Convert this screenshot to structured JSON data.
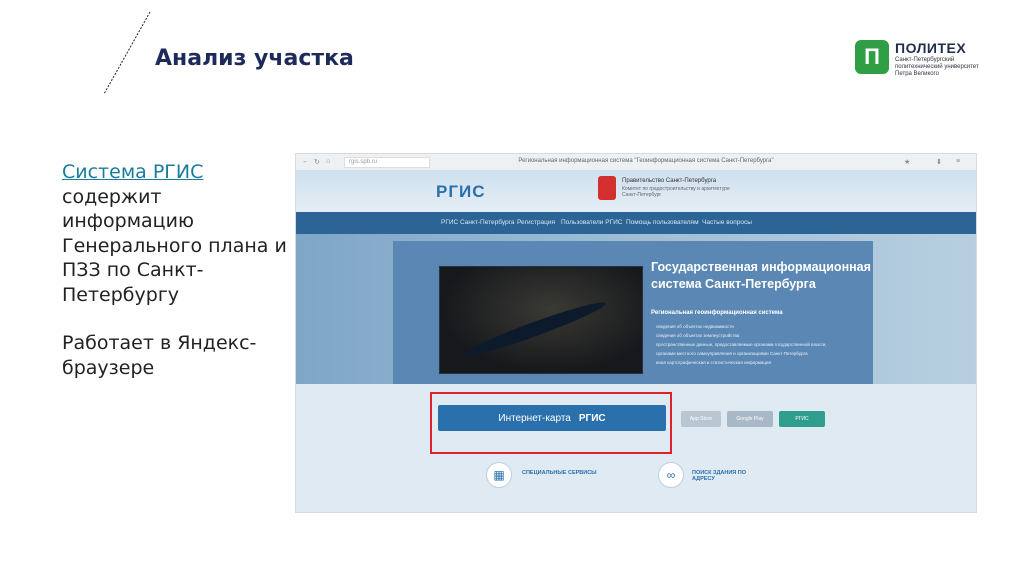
{
  "slide": {
    "title": "Анализ участка"
  },
  "logo": {
    "mark": "П",
    "name": "ПОЛИТЕХ",
    "subtitle": "Санкт-Петербургский политехнический университет Петра Великого"
  },
  "content": {
    "link_text": "Система РГИС",
    "paragraph1_rest": "содержит информацию Генерального плана и ПЗЗ по Санкт-Петербургу",
    "paragraph2": "Работает в Яндекс-браузере"
  },
  "screenshot": {
    "browser": {
      "url": "rgis.spb.ru",
      "page_title": "Региональная информационная система \"Геоинформационная система Санкт-Петербурга\""
    },
    "header": {
      "logo": "РГИС",
      "gov_line1": "Правительство Санкт-Петербурга",
      "gov_line2": "Комитет по градостроительству и архитектуре Санкт-Петербург"
    },
    "nav": [
      "РГИС Санкт-Петербурга",
      "Регистрация",
      "Пользователи РГИС",
      "Помощь пользователям",
      "Частые вопросы"
    ],
    "hero": {
      "title": "Государственная информационная система Санкт-Петербурга",
      "subtitle": "Региональная геоинформационная система",
      "items": [
        "сведения об объектах недвижимости",
        "сведения об объектах землеустройства",
        "пространственные данные, предоставляемые органами государственной власти, органами местного самоуправления и организациями Санкт-Петербурга",
        "иная картографическая и статистическая информация"
      ]
    },
    "cta": {
      "label": "Интернет-карта",
      "logo": "РГИС"
    },
    "badges": [
      "App Store",
      "Google Play",
      "РГИС"
    ],
    "services": {
      "special": "СПЕЦИАЛЬНЫЕ СЕРВИСЫ",
      "search": "ПОИСК ЗДАНИЯ ПО АДРЕСУ"
    },
    "colors": {
      "nav": "#2d6496",
      "cta": "#2a70ad",
      "highlight": "#e0202a"
    }
  }
}
